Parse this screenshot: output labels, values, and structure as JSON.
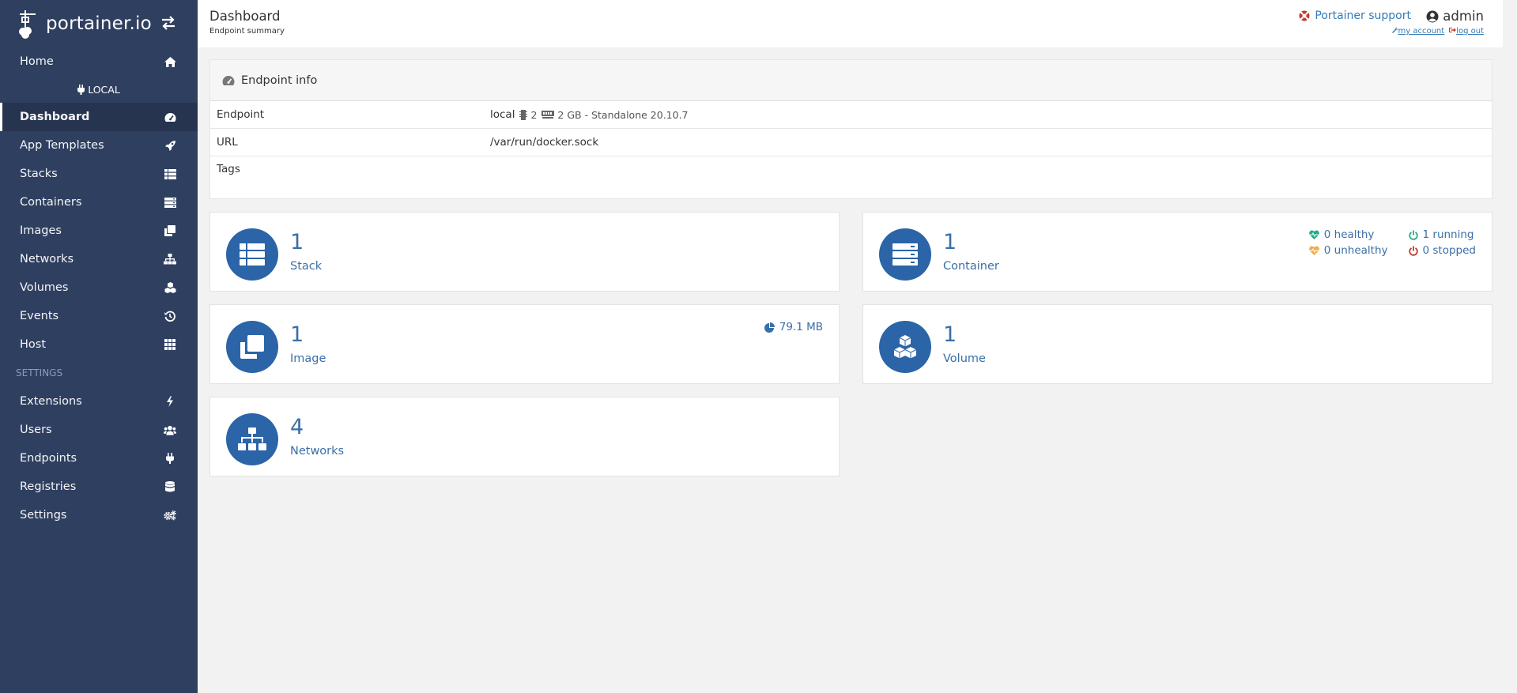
{
  "brand": {
    "logo_text": "portainer.io"
  },
  "sidebar": {
    "home_label": "Home",
    "endpoint_name": "LOCAL",
    "items": [
      {
        "label": "Dashboard",
        "icon": "tachometer-icon",
        "active": true
      },
      {
        "label": "App Templates",
        "icon": "rocket-icon"
      },
      {
        "label": "Stacks",
        "icon": "th-list-icon"
      },
      {
        "label": "Containers",
        "icon": "server-icon"
      },
      {
        "label": "Images",
        "icon": "clone-icon"
      },
      {
        "label": "Networks",
        "icon": "sitemap-icon"
      },
      {
        "label": "Volumes",
        "icon": "cubes-icon"
      },
      {
        "label": "Events",
        "icon": "history-icon"
      },
      {
        "label": "Host",
        "icon": "th-icon"
      }
    ],
    "settings_title": "SETTINGS",
    "settings_items": [
      {
        "label": "Extensions",
        "icon": "bolt-icon"
      },
      {
        "label": "Users",
        "icon": "users-icon"
      },
      {
        "label": "Endpoints",
        "icon": "plug-icon"
      },
      {
        "label": "Registries",
        "icon": "database-icon"
      },
      {
        "label": "Settings",
        "icon": "cogs-icon"
      }
    ]
  },
  "header": {
    "title": "Dashboard",
    "subtitle": "Endpoint summary",
    "support_label": "Portainer support",
    "username": "admin",
    "my_account": "my account",
    "log_out": "log out"
  },
  "endpoint_info": {
    "title": "Endpoint info",
    "rows": {
      "endpoint_key": "Endpoint",
      "endpoint_name": "local",
      "cpu": "2",
      "memory_detail": "2 GB - Standalone 20.10.7",
      "url_key": "URL",
      "url_value": "/var/run/docker.sock",
      "tags_key": "Tags"
    }
  },
  "cards": {
    "stack": {
      "count": "1",
      "label": "Stack"
    },
    "container": {
      "count": "1",
      "label": "Container",
      "healthy": "0 healthy",
      "running": "1 running",
      "unhealthy": "0 unhealthy",
      "stopped": "0 stopped"
    },
    "image": {
      "count": "1",
      "label": "Image",
      "size": "79.1 MB"
    },
    "volume": {
      "count": "1",
      "label": "Volume"
    },
    "network": {
      "count": "4",
      "label": "Networks"
    }
  },
  "colors": {
    "sidebar_bg": "#2f3f60",
    "accent": "#2c64a8",
    "healthy": "#23ae89",
    "unhealthy": "#f0ad4e",
    "stopped": "#c0392b"
  }
}
